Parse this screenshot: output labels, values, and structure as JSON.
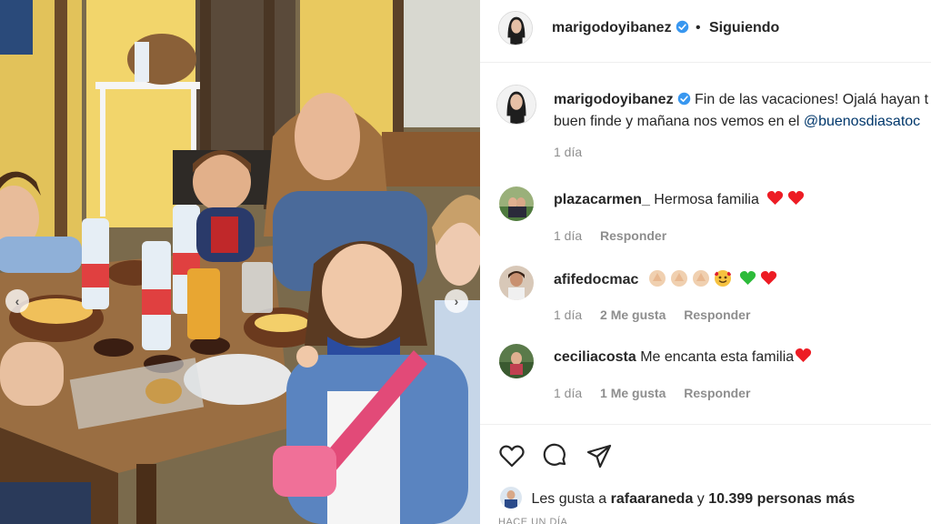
{
  "post_header": {
    "username": "marigodoyibanez",
    "separator": "•",
    "follow_status": "Siguiendo"
  },
  "caption": {
    "username": "marigodoyibanez",
    "line1": "Fin de las vacaciones! Ojalá hayan t",
    "line2_prefix": "buen finde y mañana nos vemos en el ",
    "mention": "@buenosdiasatoc",
    "time": "1 día"
  },
  "comments": [
    {
      "username": "plazacarmen_",
      "text": "Hermosa familia",
      "time": "1 día",
      "likes": "",
      "reply": "Responder"
    },
    {
      "username": "afifedocmac",
      "text": "",
      "time": "1 día",
      "likes": "2 Me gusta",
      "reply": "Responder"
    },
    {
      "username": "ceciliacosta",
      "text": "Me encanta esta familia",
      "time": "1 día",
      "likes": "1 Me gusta",
      "reply": "Responder"
    }
  ],
  "likes": {
    "prefix": "Les gusta a ",
    "user": "rafaaraneda",
    "middle": " y ",
    "others": "10.399 personas más"
  },
  "timestamp": "HACE UN DÍA",
  "icons": {
    "verified": "verified-badge-icon",
    "heart": "heart-icon",
    "comment": "comment-icon",
    "share": "share-icon",
    "prev": "chevron-left-icon",
    "next": "chevron-right-icon"
  },
  "colors": {
    "verified": "#3897f0",
    "mention": "#00376b",
    "muted": "#8e8e8e",
    "heart_red": "#ed1c24",
    "heart_green": "#2dbb3a"
  }
}
